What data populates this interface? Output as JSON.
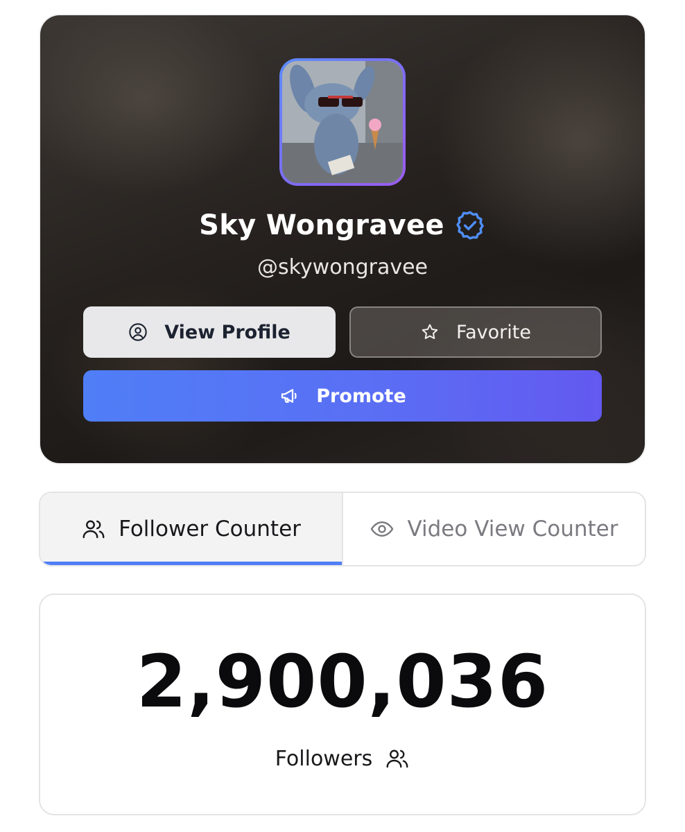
{
  "profile": {
    "name": "Sky Wongravee",
    "handle": "@skywongravee",
    "verified_icon": "verified-badge-icon",
    "avatar_description_icon": "avatar-image"
  },
  "actions": {
    "view_profile_label": "View Profile",
    "favorite_label": "Favorite",
    "promote_label": "Promote"
  },
  "tabs": [
    {
      "label": "Follower Counter",
      "icon": "users-icon",
      "active": true
    },
    {
      "label": "Video View Counter",
      "icon": "eye-icon",
      "active": false
    }
  ],
  "counter": {
    "value": "2,900,036",
    "label": "Followers",
    "icon": "users-icon"
  },
  "colors": {
    "accent": "#4f7ef7",
    "promote_gradient_start": "#4f7ef7",
    "promote_gradient_end": "#6359f0",
    "verified": "#4f8ef7"
  }
}
